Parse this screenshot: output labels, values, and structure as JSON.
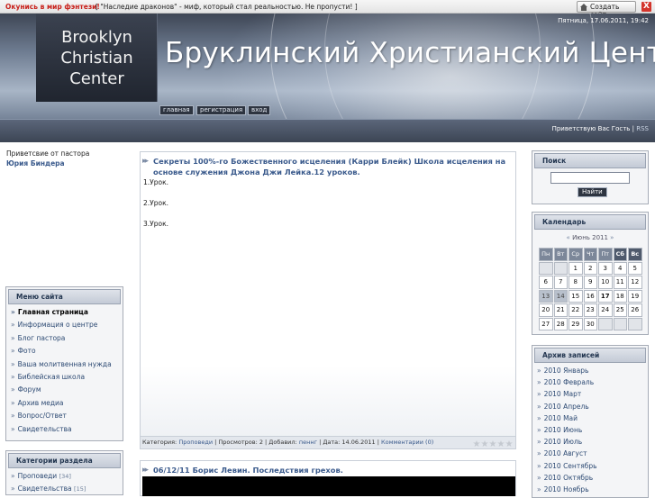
{
  "topbar": {
    "promo_link": "Окунись в мир фэнтези!",
    "promo_text": "[ \"Наследие драконов\" - миф, который стал реальностью. Не пропусти! ]",
    "create_site": "Создать сайт",
    "close": "X"
  },
  "header": {
    "logo": {
      "line1": "Brooklyn",
      "line2": "Christian",
      "line3": "Center"
    },
    "title": "Бруклинский Христианский Центр",
    "date": "Пятница, 17.06.2011, 19:42",
    "nav": {
      "home": "главная",
      "register": "регистрация",
      "login": "вход"
    },
    "greeting": "Приветствую Вас Гость",
    "separator": " | ",
    "rss": "RSS"
  },
  "left": {
    "pastor_label": "Приветсвие от пастора",
    "pastor_name": "Юрия Биндера",
    "menu": {
      "title": "Меню сайта",
      "items": [
        "Главная страница",
        "Информация о центре",
        "Блог пастора",
        "Фото",
        "Ваша молитвенная нужда",
        "Библейская школа",
        "Форум",
        "Архив медиа",
        "Вопрос/Ответ",
        "Свидетельства"
      ]
    },
    "categories": {
      "title": "Категории раздела",
      "items": [
        {
          "label": "Проповеди",
          "count": "[34]"
        },
        {
          "label": "Свидетельства",
          "count": "[15]"
        }
      ]
    }
  },
  "posts": [
    {
      "title": "Секреты 100%-го Божественного исцеления (Карри Блейк) Школа исцеления на основе служения Джона Джи Лейка.12 уроков.",
      "lines": [
        "1.Урок.",
        "2.Урок.",
        "3.Урок."
      ],
      "meta": {
        "category_label": "Категория:",
        "category": "Проповеди",
        "views": "| Просмотров: 2 | Добавил:",
        "author": "пеннг",
        "date": "| Дата: 14.06.2011 |",
        "comments": "Комментарии (0)"
      }
    },
    {
      "title": "06/12/11 Борис Левин. Последствия грехов."
    }
  ],
  "right": {
    "search": {
      "title": "Поиск",
      "button": "Найти"
    },
    "calendar": {
      "title": "Календарь",
      "prev": "«",
      "month": "Июнь 2011",
      "next": "»",
      "weekdays": [
        "Пн",
        "Вт",
        "Ср",
        "Чт",
        "Пт",
        "Сб",
        "Вс"
      ],
      "weeks": [
        [
          "",
          "",
          "1",
          "2",
          "3",
          "4",
          "5"
        ],
        [
          "6",
          "7",
          "8",
          "9",
          "10",
          "11",
          "12"
        ],
        [
          "13",
          "14",
          "15",
          "16",
          "17",
          "18",
          "19"
        ],
        [
          "20",
          "21",
          "22",
          "23",
          "24",
          "25",
          "26"
        ],
        [
          "27",
          "28",
          "29",
          "30",
          "",
          "",
          ""
        ]
      ],
      "today": "17"
    },
    "archive": {
      "title": "Архив записей",
      "items": [
        "2010 Январь",
        "2010 Февраль",
        "2010 Март",
        "2010 Апрель",
        "2010 Май",
        "2010 Июнь",
        "2010 Июль",
        "2010 Август",
        "2010 Сентябрь",
        "2010 Октябрь",
        "2010 Ноябрь"
      ]
    }
  },
  "colors": {
    "accent": "#3a5a8c",
    "promo": "#c8201a",
    "header_dark": "#2d3440"
  }
}
